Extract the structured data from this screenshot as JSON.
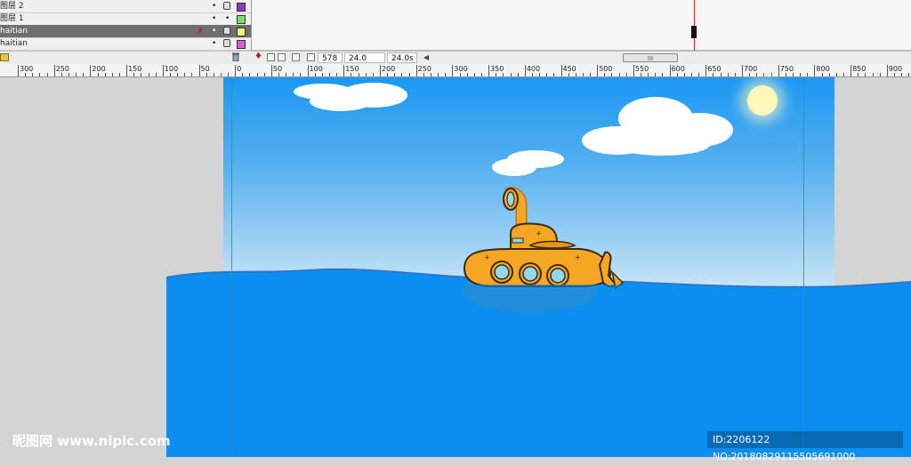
{
  "layers": [
    {
      "name": "图层 2",
      "swatch": "#8a3bb8"
    },
    {
      "name": "图层 1",
      "swatch": "#7be06a"
    },
    {
      "name": "haitian",
      "swatch": "#f5f07a"
    },
    {
      "name": "haitian",
      "swatch": "#d85bd8"
    }
  ],
  "footer": {
    "frame": "578",
    "fps": "24.0 fps",
    "time": "24.0s",
    "scroll_grip": "III"
  },
  "ruler": {
    "labels": [
      "300",
      "250",
      "200",
      "150",
      "100",
      "50",
      "0",
      "50",
      "100",
      "150",
      "200",
      "250",
      "300",
      "350",
      "400",
      "450",
      "500",
      "550",
      "600",
      "650",
      "700",
      "750",
      "800",
      "850",
      "900"
    ]
  },
  "colors": {
    "sky_top": "#1a98f2",
    "water": "#0a8ef2",
    "submarine": "#f5a623",
    "sun": "#fdf7b8"
  },
  "icons": [
    "lock-icon",
    "eye-dot-icon",
    "pencil-x-icon",
    "folder-icon",
    "trash-icon",
    "onion-skin-icon",
    "edit-multiple-icon",
    "sun-icon",
    "cloud-icon"
  ],
  "watermark": {
    "left": "昵图网 www.nipic.com",
    "right": "ID:2206122 NO:20180829115505691000"
  }
}
